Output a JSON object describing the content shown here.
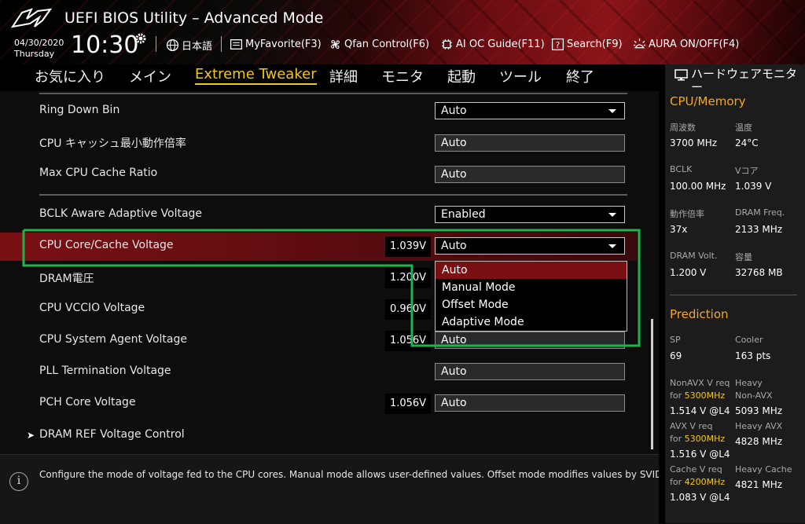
{
  "header": {
    "title": "UEFI BIOS Utility – Advanced Mode",
    "date": "04/30/2020",
    "day": "Thursday",
    "time": "10:30",
    "tools": {
      "language": "日本語",
      "myfavorite": "MyFavorite(F3)",
      "qfan": "Qfan Control(F6)",
      "aioc": "AI OC Guide(F11)",
      "search": "Search(F9)",
      "aura": "AURA ON/OFF(F4)"
    }
  },
  "tabs": [
    "お気に入り",
    "メイン",
    "Extreme Tweaker",
    "詳細",
    "モニタ",
    "起動",
    "ツール",
    "終了"
  ],
  "settings": {
    "ring_down_bin": {
      "label": "Ring Down Bin",
      "value": "Auto"
    },
    "cpu_cache_min": {
      "label": "CPU キャッシュ最小動作倍率",
      "value": "Auto"
    },
    "max_cpu_cache": {
      "label": "Max CPU Cache Ratio",
      "value": "Auto"
    },
    "bclk_aware": {
      "label": "BCLK Aware Adaptive Voltage",
      "value": "Enabled"
    },
    "cpu_core_voltage": {
      "label": "CPU Core/Cache Voltage",
      "reading": "1.039V",
      "value": "Auto"
    },
    "dram_voltage": {
      "label": "DRAM電圧",
      "reading": "1.200V"
    },
    "cpu_vccio": {
      "label": "CPU VCCIO Voltage",
      "reading": "0.960V"
    },
    "cpu_sa": {
      "label": "CPU System Agent Voltage",
      "reading": "1.056V",
      "value": "Auto"
    },
    "pll_term": {
      "label": "PLL Termination Voltage",
      "value": "Auto"
    },
    "pch_core": {
      "label": "PCH Core Voltage",
      "reading": "1.056V",
      "value": "Auto"
    },
    "dram_ref": {
      "label": "DRAM REF Voltage Control"
    }
  },
  "dropdown_options": [
    "Auto",
    "Manual Mode",
    "Offset Mode",
    "Adaptive Mode"
  ],
  "info": "Configure the mode of voltage fed to the CPU cores. Manual mode allows user-defined values. Offset mode modifies values by SVID.",
  "monitor": {
    "title": "ハードウェアモニター",
    "cpu_memory": "CPU/Memory",
    "freq_label": "周波数",
    "freq": "3700 MHz",
    "temp_label": "温度",
    "temp": "24°C",
    "bclk_label": "BCLK",
    "bclk": "100.00 MHz",
    "vcore_label": "Vコア",
    "vcore": "1.039 V",
    "ratio_label": "動作倍率",
    "ratio": "37x",
    "dram_freq_label": "DRAM Freq.",
    "dram_freq": "2133 MHz",
    "dram_volt_label": "DRAM Volt.",
    "dram_volt": "1.200 V",
    "capacity_label": "容量",
    "capacity": "32768 MB",
    "prediction": "Prediction",
    "sp_label": "SP",
    "sp": "69",
    "cooler_label": "Cooler",
    "cooler": "163 pts",
    "nonavx_label1": "NonAVX V req",
    "nonavx_label2": "for",
    "nonavx_freq": "5300MHz",
    "nonavx": "1.514 V @L4",
    "heavy_nonavx_label1": "Heavy",
    "heavy_nonavx_label2": "Non-AVX",
    "heavy_nonavx": "5093 MHz",
    "avx_label1": "AVX V req",
    "avx_label2": "for",
    "avx_freq": "5300MHz",
    "avx": "1.516 V @L4",
    "heavy_avx_label": "Heavy AVX",
    "heavy_avx": "4828 MHz",
    "cache_label1": "Cache V req",
    "cache_label2": "for",
    "cache_freq": "4200MHz",
    "cache": "1.083 V @L4",
    "heavy_cache_label": "Heavy Cache",
    "heavy_cache": "4821 MHz"
  },
  "colors": {
    "accent": "#f5c518",
    "section": "#f5a623",
    "highlight": "#7a1014",
    "annotation": "#22b24c"
  }
}
